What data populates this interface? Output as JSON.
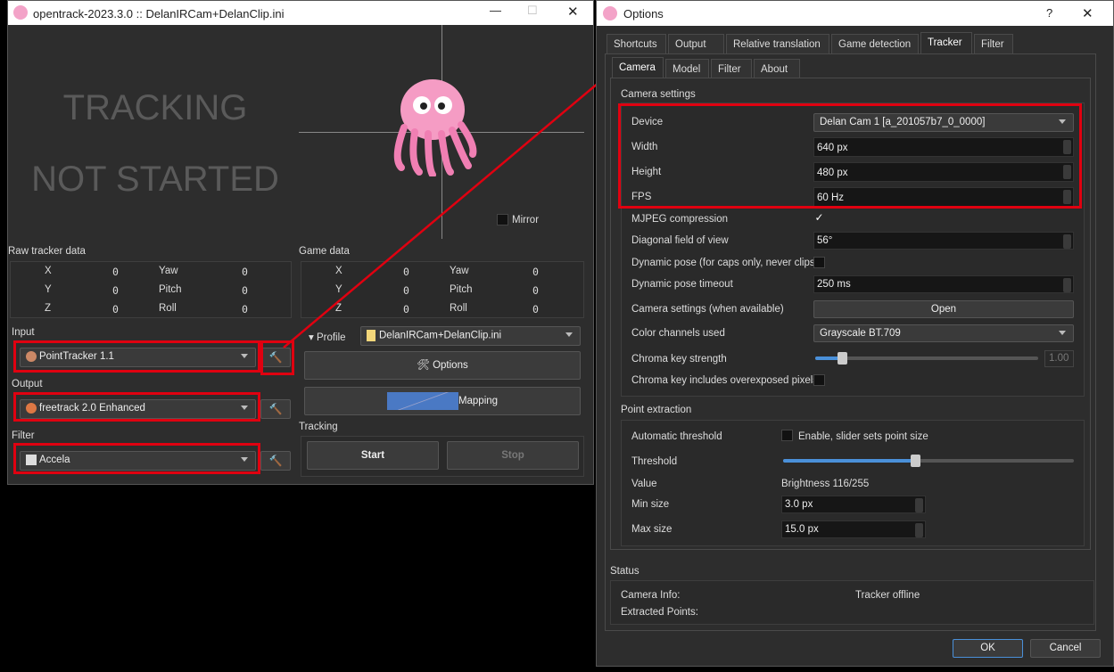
{
  "main_window": {
    "title": "opentrack-2023.3.0 :: DelanIRCam+DelanClip.ini",
    "status_line1": "TRACKING",
    "status_line2": "NOT STARTED",
    "mirror_label": "Mirror",
    "raw_tracker_data": {
      "label": "Raw tracker data",
      "rows": [
        {
          "axis": "X",
          "value": "0",
          "rot": "Yaw",
          "rot_value": "0"
        },
        {
          "axis": "Y",
          "value": "0",
          "rot": "Pitch",
          "rot_value": "0"
        },
        {
          "axis": "Z",
          "value": "0",
          "rot": "Roll",
          "rot_value": "0"
        }
      ]
    },
    "game_data": {
      "label": "Game data",
      "rows": [
        {
          "axis": "X",
          "value": "0",
          "rot": "Yaw",
          "rot_value": "0"
        },
        {
          "axis": "Y",
          "value": "0",
          "rot": "Pitch",
          "rot_value": "0"
        },
        {
          "axis": "Z",
          "value": "0",
          "rot": "Roll",
          "rot_value": "0"
        }
      ]
    },
    "input": {
      "label": "Input",
      "value": "PointTracker 1.1"
    },
    "output": {
      "label": "Output",
      "value": "freetrack 2.0 Enhanced"
    },
    "filter": {
      "label": "Filter",
      "value": "Accela"
    },
    "profile": {
      "label": "Profile",
      "value": "DelanIRCam+DelanClip.ini"
    },
    "options_label": "Options",
    "mapping_label": "Mapping",
    "tracking": {
      "label": "Tracking",
      "start": "Start",
      "stop": "Stop"
    }
  },
  "options_window": {
    "title": "Options",
    "help": "?",
    "close": "✕",
    "tabs": [
      "Shortcuts",
      "Output",
      "Relative translation",
      "Game detection",
      "Tracker",
      "Filter"
    ],
    "active_tab": "Tracker",
    "subtabs": [
      "Camera",
      "Model",
      "Filter",
      "About"
    ],
    "active_subtab": "Camera",
    "camera_settings": {
      "title": "Camera settings",
      "device": {
        "label": "Device",
        "value": "Delan Cam 1 [a_201057b7_0_0000]"
      },
      "width": {
        "label": "Width",
        "value": "640 px"
      },
      "height": {
        "label": "Height",
        "value": "480 px"
      },
      "fps": {
        "label": "FPS",
        "value": "60 Hz"
      },
      "mjpeg": {
        "label": "MJPEG compression",
        "checked": true,
        "mark": "✓"
      },
      "fov": {
        "label": "Diagonal field of view",
        "value": "56°"
      },
      "dynamic_pose": {
        "label": "Dynamic pose (for caps only, never clips)",
        "checked": false
      },
      "dynamic_timeout": {
        "label": "Dynamic pose timeout",
        "value": "250 ms"
      },
      "cam_settings": {
        "label": "Camera settings (when available)",
        "button": "Open"
      },
      "color_channels": {
        "label": "Color channels used",
        "value": "Grayscale BT.709"
      },
      "chroma_strength": {
        "label": "Chroma key strength",
        "value": "1.00",
        "slider_fraction": 0.12
      },
      "chroma_overexposed": {
        "label": "Chroma key includes overexposed pixels",
        "checked": false
      }
    },
    "point_extraction": {
      "title": "Point extraction",
      "auto_threshold": {
        "label": "Automatic threshold",
        "checkbox_label": "Enable, slider sets point size",
        "checked": false
      },
      "threshold": {
        "label": "Threshold",
        "slider_fraction": 0.455
      },
      "value": {
        "label": "Value",
        "text": "Brightness 116/255"
      },
      "min_size": {
        "label": "Min size",
        "value": "3.0 px"
      },
      "max_size": {
        "label": "Max size",
        "value": "15.0 px"
      }
    },
    "status": {
      "title": "Status",
      "camera_info_label": "Camera Info:",
      "camera_info_value": "Tracker offline",
      "extracted_label": "Extracted Points:"
    },
    "ok": "OK",
    "cancel": "Cancel"
  },
  "colors": {
    "highlight": "#e00010",
    "accent": "#4a90d9"
  }
}
